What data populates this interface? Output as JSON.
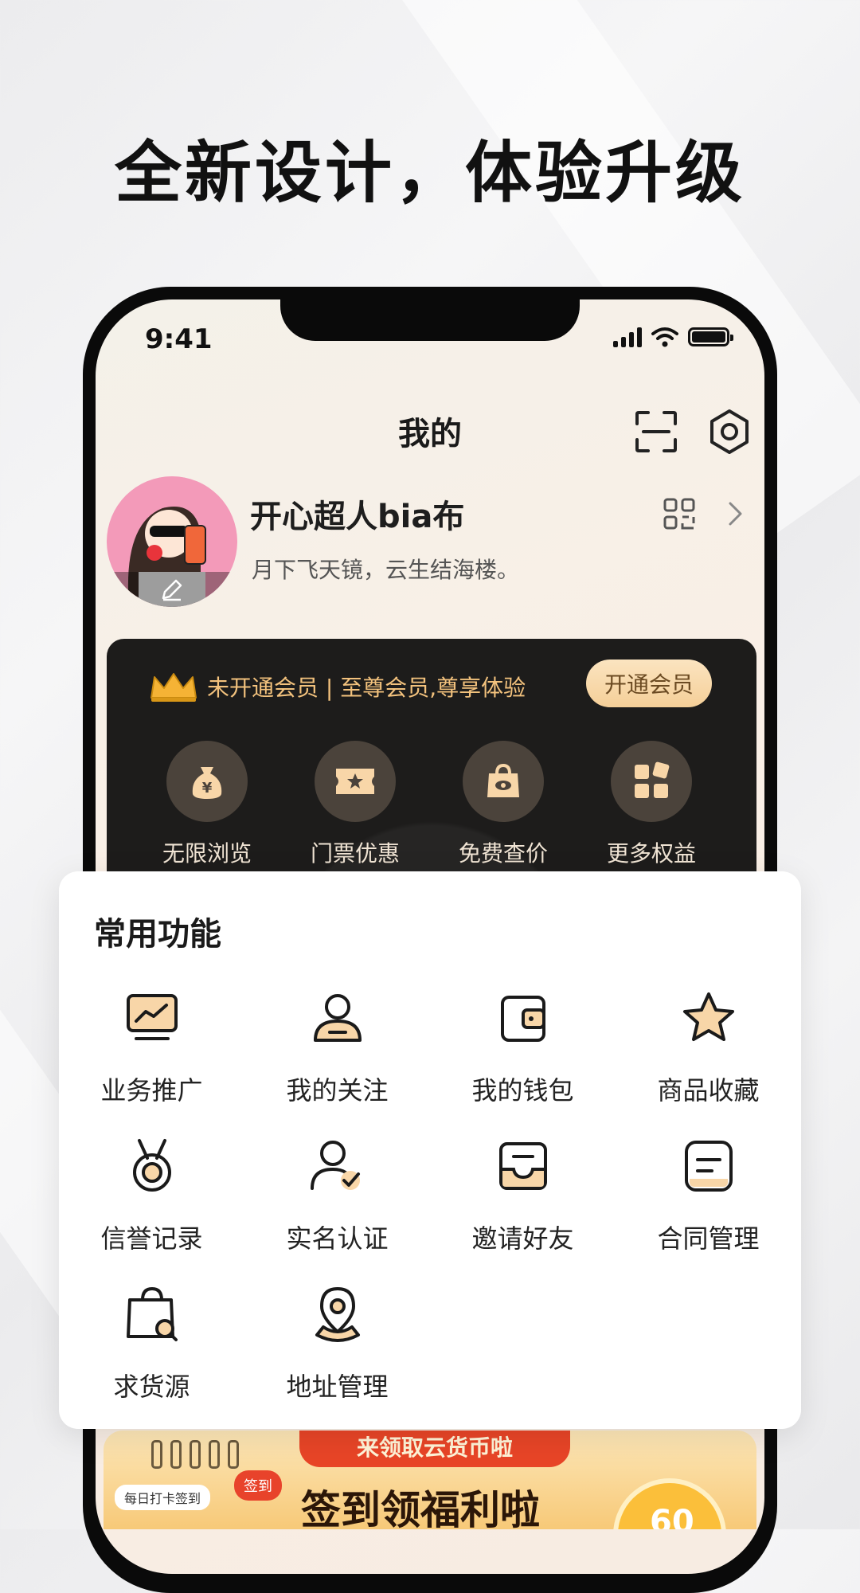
{
  "headline": "全新设计，体验升级",
  "status": {
    "time": "9:41"
  },
  "header": {
    "title": "我的"
  },
  "profile": {
    "name": "开心超人bia布",
    "bio": "月下飞天镜，云生结海楼。"
  },
  "vip": {
    "text": "未开通会员 | 至尊会员,尊享体验",
    "button": "开通会员",
    "benefits": [
      {
        "label": "无限浏览",
        "icon": "money-bag-icon"
      },
      {
        "label": "门票优惠",
        "icon": "ticket-icon"
      },
      {
        "label": "免费查价",
        "icon": "shopping-bag-eye-icon"
      },
      {
        "label": "更多权益",
        "icon": "grid-icon"
      }
    ]
  },
  "functions": {
    "title": "常用功能",
    "items": [
      {
        "label": "业务推广",
        "icon": "chart-monitor-icon"
      },
      {
        "label": "我的关注",
        "icon": "person-icon"
      },
      {
        "label": "我的钱包",
        "icon": "wallet-icon"
      },
      {
        "label": "商品收藏",
        "icon": "star-icon"
      },
      {
        "label": "信誉记录",
        "icon": "medal-icon"
      },
      {
        "label": "实名认证",
        "icon": "person-check-icon"
      },
      {
        "label": "邀请好友",
        "icon": "inbox-icon"
      },
      {
        "label": "合同管理",
        "icon": "document-icon"
      },
      {
        "label": "求货源",
        "icon": "bag-search-icon"
      },
      {
        "label": "地址管理",
        "icon": "location-pin-icon"
      }
    ]
  },
  "banner": {
    "ribbon": "来领取云货币啦",
    "main": "签到领福利啦",
    "tag_daily": "每日打卡签到",
    "tag_sign": "签到",
    "coin": "60"
  },
  "colors": {
    "accent_gold": "#f3c27d",
    "icon_peach": "#f8d6a8",
    "vip_card": "#1d1c1b"
  }
}
